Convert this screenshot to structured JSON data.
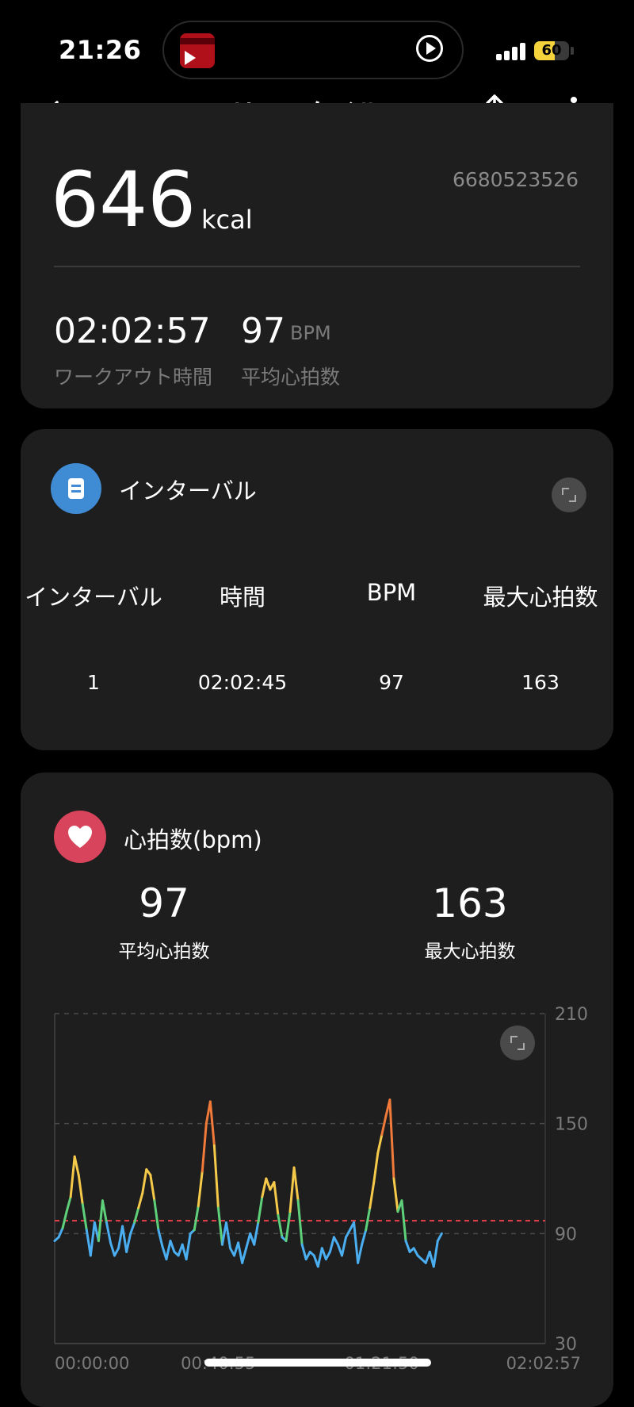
{
  "status_bar": {
    "time": "21:26",
    "battery": "60",
    "battery_level": 0.6
  },
  "nav": {
    "title": "フリースタイル",
    "back_icon": "back-arrow-icon",
    "share_icon": "share-icon",
    "more_icon": "more-vertical-icon"
  },
  "summary": {
    "calories": "646",
    "calories_unit": "kcal",
    "session_id": "6680523526",
    "duration": "02:02:57",
    "duration_label": "ワークアウト時間",
    "avg_hr": "97",
    "avg_hr_unit": "BPM",
    "avg_hr_label": "平均心拍数"
  },
  "intervals": {
    "title": "インターバル",
    "icon": "interval-icon",
    "headers": [
      "インターバル",
      "時間",
      "BPM",
      "最大心拍数"
    ],
    "rows": [
      [
        "1",
        "02:02:45",
        "97",
        "163"
      ]
    ]
  },
  "heart_rate": {
    "title": "心拍数(bpm)",
    "icon": "heart-icon",
    "avg_value": "97",
    "avg_label": "平均心拍数",
    "max_value": "163",
    "max_label": "最大心拍数"
  },
  "chart_data": {
    "type": "line",
    "title": "",
    "xlabel": "",
    "ylabel": "",
    "ylim": [
      30,
      210
    ],
    "y_ticks": [
      210,
      150,
      90,
      30
    ],
    "x_tick_labels": [
      "00:00:00",
      "00:40:55",
      "01:21:50",
      "02:02:57"
    ],
    "xlim_minutes": [
      0,
      122.95
    ],
    "average_line": 97,
    "grid": true,
    "colors": {
      "low": "#4aaef0",
      "mid": "#5fd07a",
      "high": "#f5c94a",
      "peak": "#f07a3a",
      "average": "#e8404f"
    },
    "series": [
      {
        "x_minutes": [
          0,
          1,
          2,
          3,
          4,
          5,
          6,
          7,
          8,
          9,
          10,
          11,
          12,
          13,
          14,
          15,
          16,
          17,
          18,
          19,
          20,
          21,
          22,
          23,
          24,
          25,
          26,
          27,
          28,
          29,
          30,
          31,
          32,
          33,
          34,
          35,
          36,
          37,
          38,
          39,
          40,
          41,
          42,
          43,
          44,
          45,
          46,
          47,
          48,
          49,
          50,
          51,
          52,
          53,
          54,
          55,
          56,
          57,
          58,
          59,
          60,
          61,
          62,
          63,
          64,
          65,
          66,
          67,
          68,
          69,
          70,
          71,
          72,
          73,
          74,
          75,
          76,
          77,
          78,
          79,
          80,
          81,
          82,
          83,
          84,
          85,
          86,
          87,
          88,
          89,
          90,
          91,
          92,
          93,
          94,
          95,
          96,
          97,
          98,
          99,
          100,
          101,
          102,
          103,
          104,
          105,
          106,
          107,
          108,
          109,
          110,
          111,
          112,
          113,
          114,
          115,
          116,
          117,
          118,
          119,
          120,
          121,
          122,
          122.95
        ],
        "values": [
          86,
          88,
          93,
          102,
          110,
          132,
          122,
          106,
          92,
          78,
          96,
          86,
          108,
          96,
          85,
          78,
          82,
          94,
          80,
          90,
          96,
          104,
          112,
          125,
          122,
          108,
          92,
          83,
          76,
          86,
          80,
          78,
          84,
          76,
          90,
          92,
          105,
          124,
          150,
          162,
          138,
          104,
          84,
          96,
          82,
          78,
          85,
          74,
          82,
          90,
          84,
          96,
          110,
          120,
          114,
          118,
          100,
          88,
          86,
          102,
          126,
          108,
          84,
          76,
          80,
          78,
          72,
          82,
          76,
          80,
          88,
          84,
          78,
          88,
          92,
          96,
          74,
          84,
          92,
          104,
          118,
          134,
          144,
          154,
          163,
          120,
          102,
          108,
          86,
          80,
          82,
          78,
          76,
          74,
          80,
          72,
          86,
          90
        ]
      }
    ]
  },
  "chart_expand_icon": "expand-icon"
}
